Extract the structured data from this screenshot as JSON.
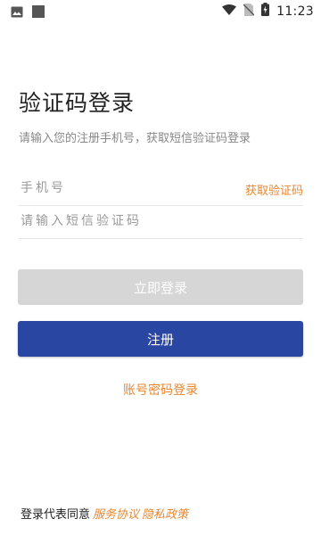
{
  "status_bar": {
    "time": "11:23",
    "left_icons": [
      "image-icon",
      "square-icon"
    ],
    "right_icons": [
      "wifi-icon",
      "no-sim-icon",
      "battery-charging-icon"
    ]
  },
  "page": {
    "title": "验证码登录",
    "subtitle": "请输入您的注册手机号，获取短信验证码登录"
  },
  "form": {
    "phone_placeholder": "手机号",
    "get_code_label": "获取验证码",
    "code_placeholder": "请输入短信验证码"
  },
  "buttons": {
    "login_label": "立即登录",
    "register_label": "注册",
    "password_login_label": "账号密码登录"
  },
  "agreement": {
    "prefix": "登录代表同意",
    "service_label": "服务协议",
    "privacy_label": "隐私政策"
  },
  "colors": {
    "accent_orange": "#e8872f",
    "primary_blue": "#2a46a3",
    "disabled_gray": "#d6d6d6"
  }
}
